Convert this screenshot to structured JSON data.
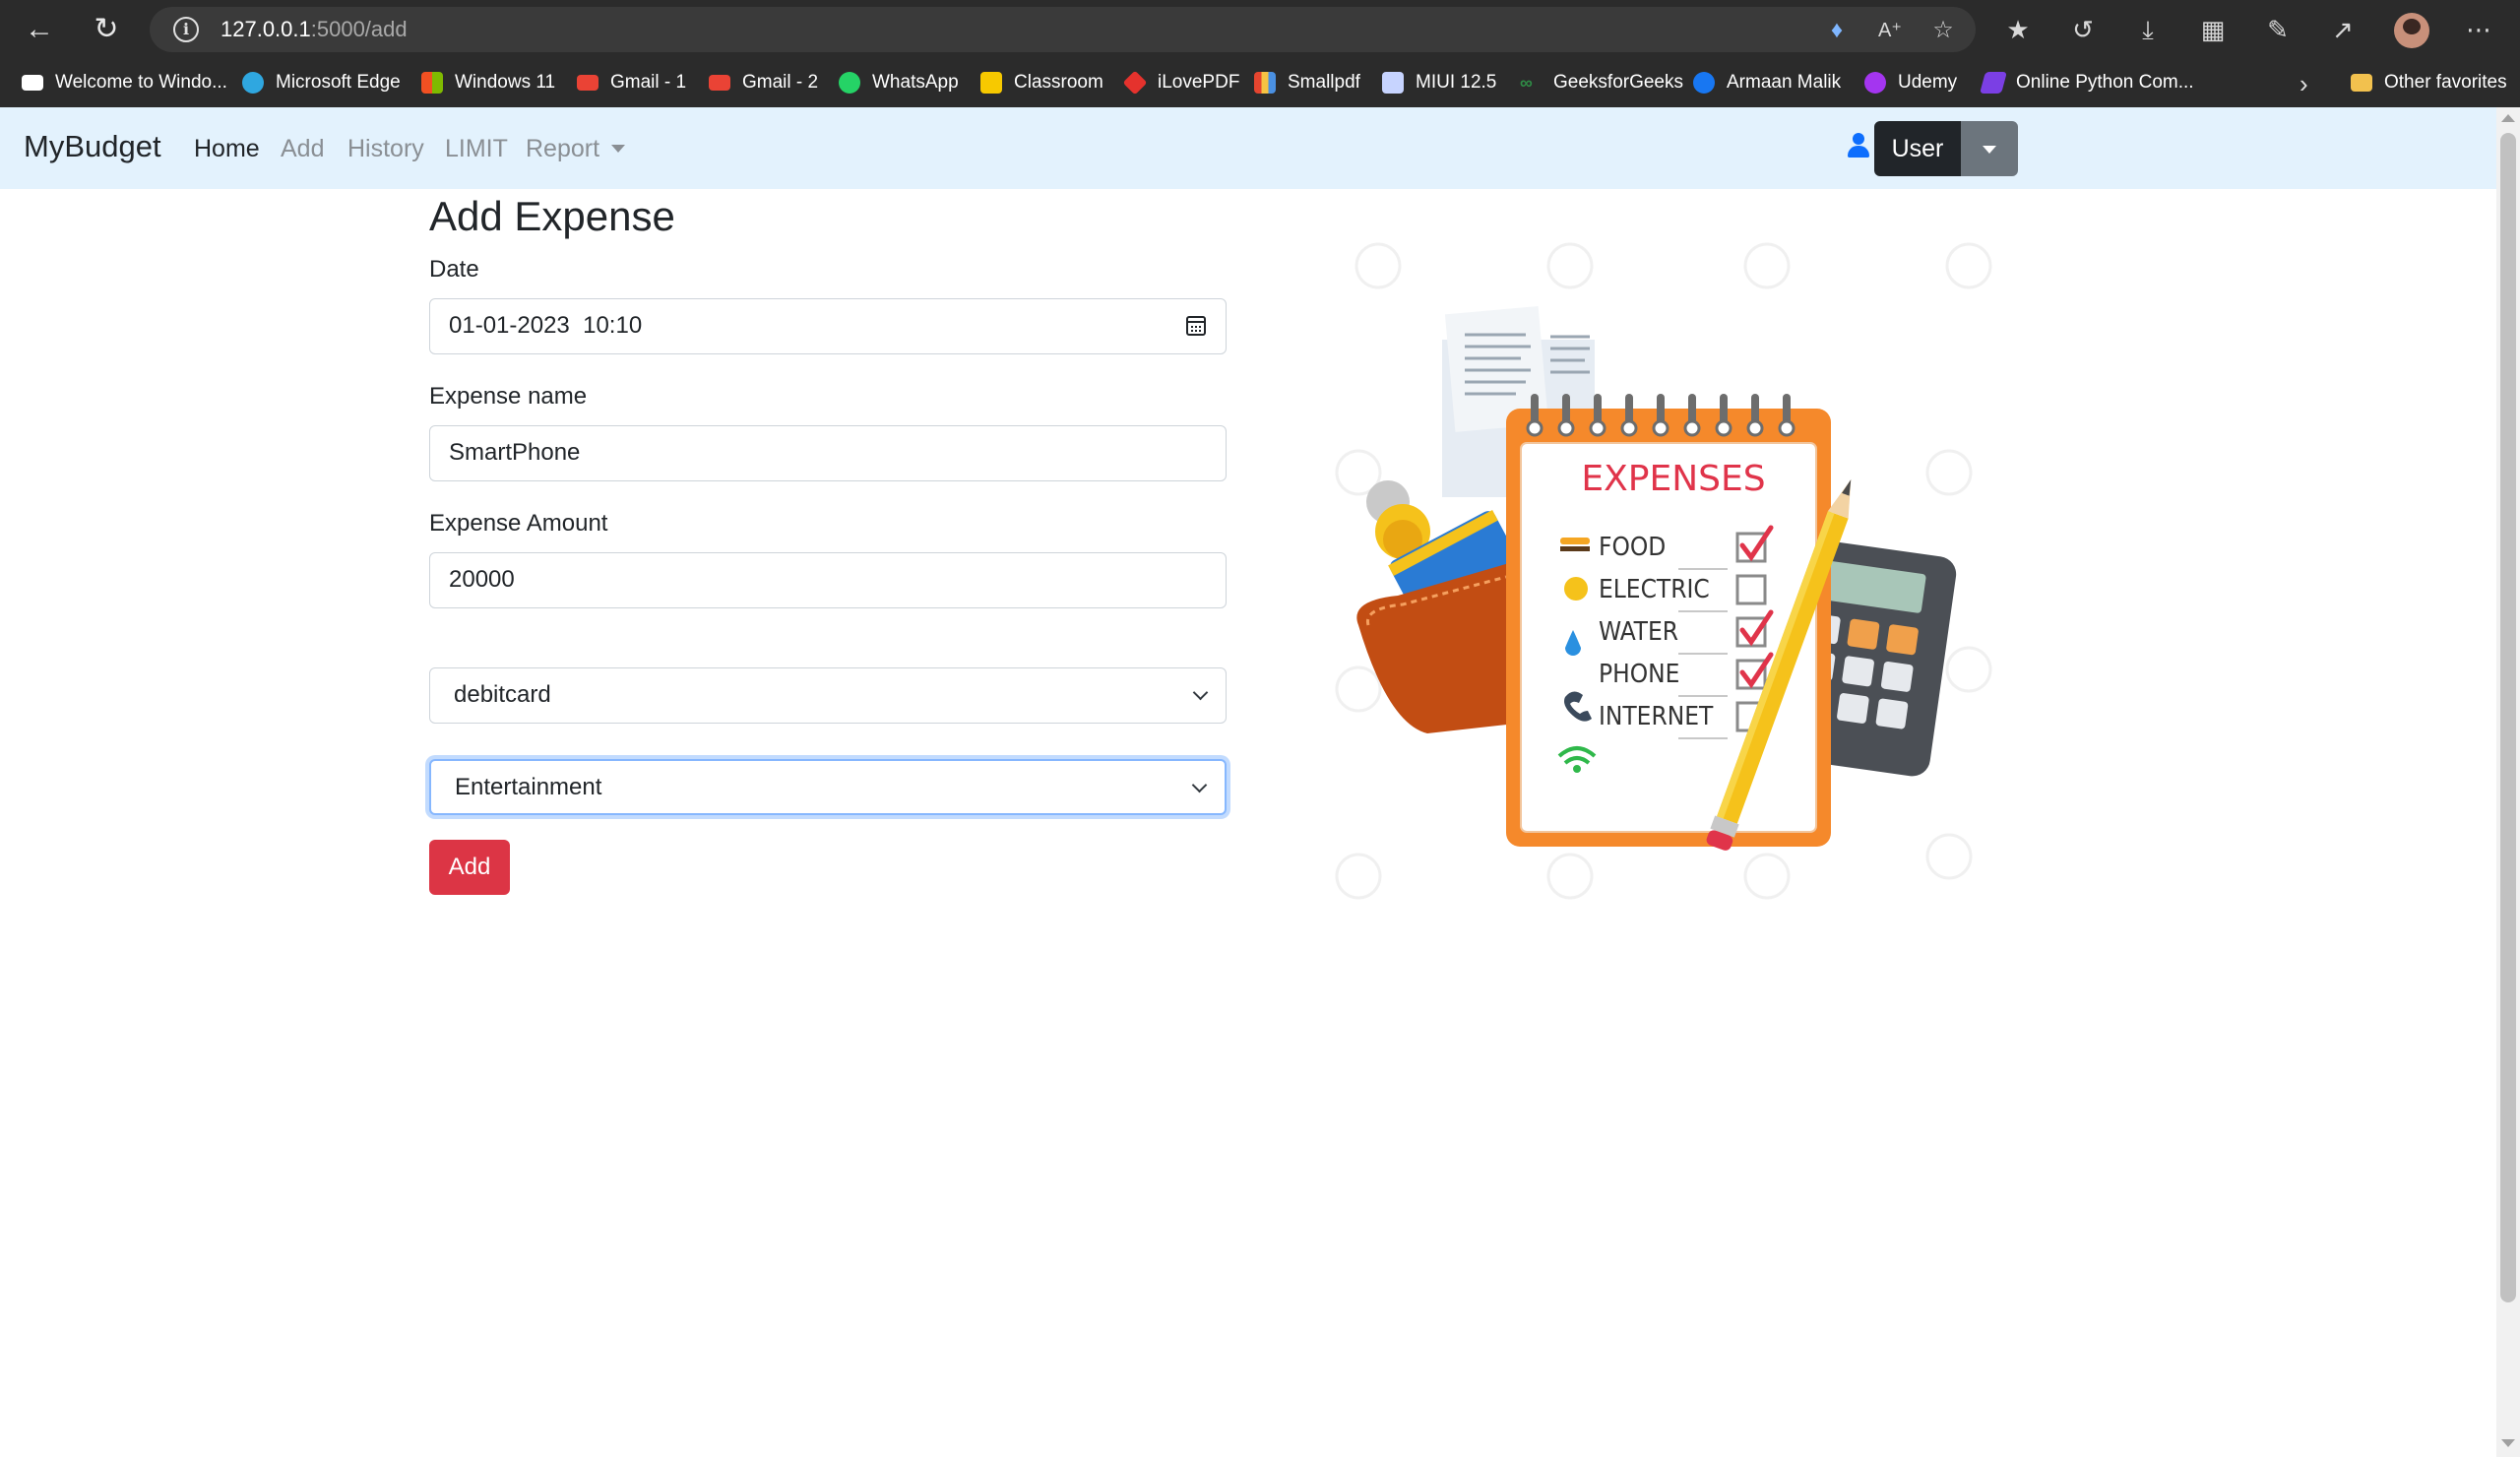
{
  "browser": {
    "url_host": "127.0.0.1",
    "url_path": ":5000/add",
    "bookmarks": [
      {
        "label": "Welcome to Windo...",
        "color": "#ffffff"
      },
      {
        "label": "Microsoft Edge",
        "color": "#2fa7e0"
      },
      {
        "label": "Windows 11",
        "color": "#f25022"
      },
      {
        "label": "Gmail - 1",
        "color": "#ea4335"
      },
      {
        "label": "Gmail - 2",
        "color": "#ea4335"
      },
      {
        "label": "WhatsApp",
        "color": "#25d366"
      },
      {
        "label": "Classroom",
        "color": "#f7c900"
      },
      {
        "label": "iLovePDF",
        "color": "#e5322d"
      },
      {
        "label": "Smallpdf",
        "color": "#e6452f"
      },
      {
        "label": "MIUI 12.5",
        "color": "#c7d4ff"
      },
      {
        "label": "GeeksforGeeks",
        "color": "#2f8d46"
      },
      {
        "label": "Armaan Malik",
        "color": "#1877f2"
      },
      {
        "label": "Udemy",
        "color": "#a435f0"
      },
      {
        "label": "Online Python Com...",
        "color": "#7b3fe4"
      }
    ],
    "other_favorites": "Other favorites"
  },
  "navbar": {
    "brand": "MyBudget",
    "links": [
      "Home",
      "Add",
      "History",
      "LIMIT",
      "Report"
    ],
    "user_label": "User"
  },
  "form": {
    "title": "Add Expense",
    "date_label": "Date",
    "date_value": "01-01-2023  10:10",
    "name_label": "Expense name",
    "name_value": "SmartPhone",
    "amount_label": "Expense Amount",
    "amount_value": "20000",
    "payment_selected": "debitcard",
    "category_selected": "Entertainment",
    "submit_label": "Add"
  },
  "illustration": {
    "title": "EXPENSES",
    "items": [
      {
        "label": "FOOD",
        "checked": true
      },
      {
        "label": "ELECTRIC",
        "checked": false
      },
      {
        "label": "WATER",
        "checked": true
      },
      {
        "label": "PHONE",
        "checked": true
      },
      {
        "label": "INTERNET",
        "checked": false
      }
    ]
  },
  "colors": {
    "navbar_bg": "#e3f2fd",
    "danger": "#dc3545",
    "primary": "#0d6efd",
    "notepad_orange": "#f5892b"
  }
}
